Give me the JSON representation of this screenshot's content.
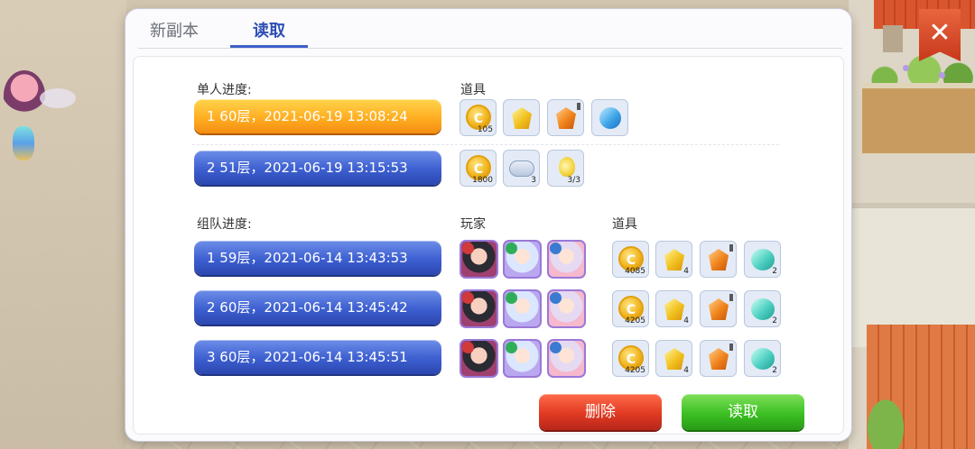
{
  "tabs": {
    "new_label": "新副本",
    "load_label": "读取"
  },
  "close_label": "✕",
  "solo": {
    "label": "单人进度:",
    "items_label": "道具",
    "records": [
      {
        "text": "1  60层，2021-06-19 13:08:24",
        "selected": true,
        "items": [
          {
            "kind": "coin",
            "qty": "105"
          },
          {
            "kind": "gem-gold",
            "qty": ""
          },
          {
            "kind": "gem-orange",
            "qty": ""
          },
          {
            "kind": "gem-blue",
            "qty": ""
          }
        ]
      },
      {
        "text": "2  51层，2021-06-19 13:15:53",
        "selected": false,
        "items": [
          {
            "kind": "coin",
            "qty": "1800"
          },
          {
            "kind": "scroll",
            "qty": "3"
          },
          {
            "kind": "potion",
            "qty": "3/3"
          }
        ]
      }
    ]
  },
  "team": {
    "label": "组队进度:",
    "players_label": "玩家",
    "items_label": "道具",
    "records": [
      {
        "text": "1  59层，2021-06-14 13:43:53",
        "items": [
          {
            "kind": "coin",
            "qty": "4085"
          },
          {
            "kind": "gem-gold",
            "qty": "4"
          },
          {
            "kind": "gem-orange",
            "qty": ""
          },
          {
            "kind": "gem-cyan",
            "qty": "2"
          }
        ]
      },
      {
        "text": "2  60层，2021-06-14 13:45:42",
        "items": [
          {
            "kind": "coin",
            "qty": "4205"
          },
          {
            "kind": "gem-gold",
            "qty": "4"
          },
          {
            "kind": "gem-orange",
            "qty": ""
          },
          {
            "kind": "gem-cyan",
            "qty": "2"
          }
        ]
      },
      {
        "text": "3  60层，2021-06-14 13:45:51",
        "items": [
          {
            "kind": "coin",
            "qty": "4205"
          },
          {
            "kind": "gem-gold",
            "qty": "4"
          },
          {
            "kind": "gem-orange",
            "qty": ""
          },
          {
            "kind": "gem-cyan",
            "qty": "2"
          }
        ]
      }
    ]
  },
  "buttons": {
    "delete": "删除",
    "load": "读取"
  },
  "coin_glyph": "C",
  "colors": {
    "tab_active": "#2f4fb5",
    "record_blue": "#3d5fd0",
    "record_selected": "#ffae22",
    "delete": "#e03a22",
    "load": "#3cc023"
  }
}
